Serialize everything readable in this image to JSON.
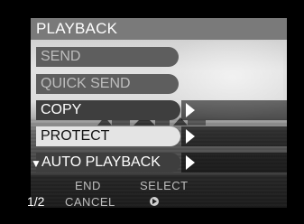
{
  "header": {
    "title": "PLAYBACK"
  },
  "menu": {
    "items": [
      {
        "label": "SEND",
        "state": "disabled"
      },
      {
        "label": "QUICK SEND",
        "state": "disabled"
      },
      {
        "label": "COPY",
        "state": "enabled"
      },
      {
        "label": "PROTECT",
        "state": "selected"
      },
      {
        "label": "AUTO PLAYBACK",
        "state": "enabled"
      }
    ]
  },
  "footer": {
    "page": "1/2",
    "end": "END",
    "cancel": "CANCEL",
    "select": "SELECT"
  }
}
